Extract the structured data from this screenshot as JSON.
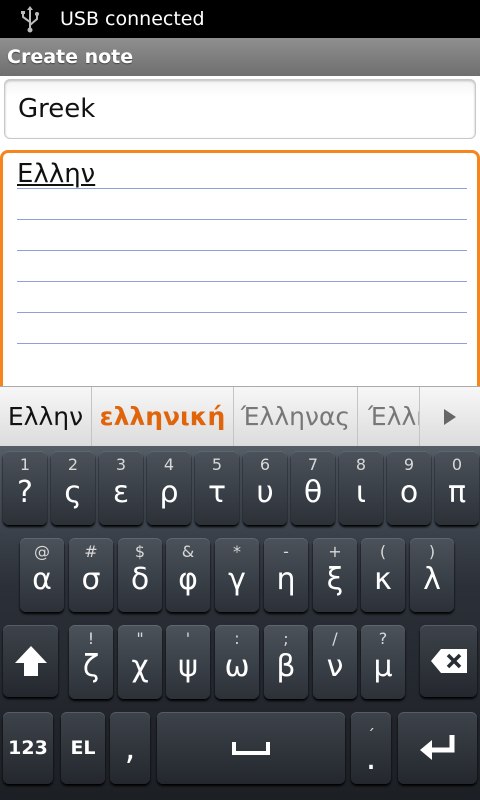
{
  "status_bar": {
    "text": "USB connected",
    "icon": "usb-icon"
  },
  "title_bar": {
    "title": "Create note"
  },
  "note": {
    "title_value": "Greek",
    "body_value": "Ελλην",
    "info_icon": "info-icon"
  },
  "suggestions": {
    "items": [
      "Ελλην",
      "ελληνική",
      "Έλληνας",
      "Έλλη"
    ],
    "more_icon": "chevron-right-icon"
  },
  "keyboard": {
    "row1": [
      {
        "alt": "1",
        "main": "?"
      },
      {
        "alt": "2",
        "main": "ς"
      },
      {
        "alt": "3",
        "main": "ε"
      },
      {
        "alt": "4",
        "main": "ρ"
      },
      {
        "alt": "5",
        "main": "τ"
      },
      {
        "alt": "6",
        "main": "υ"
      },
      {
        "alt": "7",
        "main": "θ"
      },
      {
        "alt": "8",
        "main": "ι"
      },
      {
        "alt": "9",
        "main": "ο"
      },
      {
        "alt": "0",
        "main": "π"
      }
    ],
    "row2": [
      {
        "alt": "@",
        "main": "α"
      },
      {
        "alt": "#",
        "main": "σ"
      },
      {
        "alt": "$",
        "main": "δ"
      },
      {
        "alt": "&",
        "main": "φ"
      },
      {
        "alt": "*",
        "main": "γ"
      },
      {
        "alt": "-",
        "main": "η"
      },
      {
        "alt": "+",
        "main": "ξ"
      },
      {
        "alt": "(",
        "main": "κ"
      },
      {
        "alt": ")",
        "main": "λ"
      }
    ],
    "row3": [
      {
        "alt": "!",
        "main": "ζ"
      },
      {
        "alt": "\"",
        "main": "χ"
      },
      {
        "alt": "'",
        "main": "ψ"
      },
      {
        "alt": ":",
        "main": "ω"
      },
      {
        "alt": ";",
        "main": "β"
      },
      {
        "alt": "/",
        "main": "ν"
      },
      {
        "alt": "?",
        "main": "μ"
      }
    ],
    "shift_icon": "shift-icon",
    "backspace_icon": "backspace-icon",
    "numbers_label": "123",
    "language_label": "EL",
    "comma_label": ",",
    "space_icon": "space-icon",
    "period_alt": "΄",
    "period_label": ".",
    "enter_icon": "enter-icon"
  }
}
